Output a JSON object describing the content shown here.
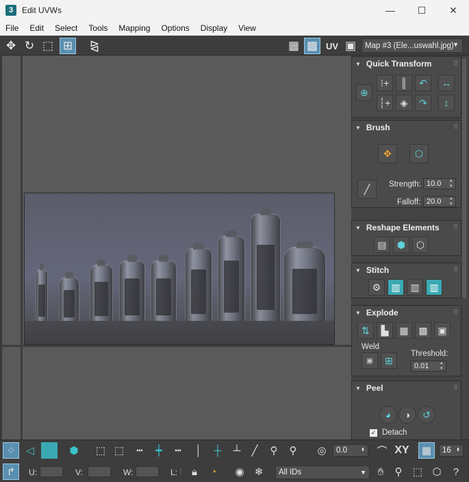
{
  "window": {
    "title": "Edit UVWs",
    "app_icon": "3",
    "minimize": "—",
    "maximize": "☐",
    "close": "✕"
  },
  "menu": [
    "File",
    "Edit",
    "Select",
    "Tools",
    "Mapping",
    "Options",
    "Display",
    "View"
  ],
  "toolbar": {
    "uv_label": "UV",
    "map_select": "Map #3 (Ele...uswahl.jpg)"
  },
  "panel": {
    "quick_transform": {
      "title": "Quick Transform"
    },
    "brush": {
      "title": "Brush",
      "strength_label": "Strength:",
      "strength_value": "10.0",
      "falloff_label": "Falloff:",
      "falloff_value": "20.0"
    },
    "reshape": {
      "title": "Reshape Elements"
    },
    "stitch": {
      "title": "Stitch"
    },
    "explode": {
      "title": "Explode",
      "weld_label": "Weld",
      "threshold_label": "Threshold:",
      "threshold_value": "0.01"
    },
    "peel": {
      "title": "Peel",
      "detach_label": "Detach",
      "detach_checked": true
    }
  },
  "bottom": {
    "offset_value": "0.0",
    "xy_label": "XY",
    "grid_value": "16",
    "u_label": "U:",
    "v_label": "V:",
    "w_label": "W:",
    "l_label": "L:",
    "ids_select": "All IDs"
  },
  "colors": {
    "accent": "#3aa9b3",
    "active_blue": "#5a8fb0",
    "bg": "#444444"
  }
}
